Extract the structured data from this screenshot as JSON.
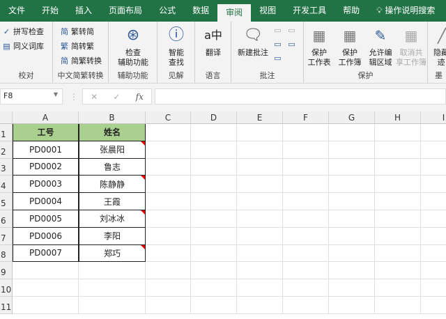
{
  "tabs": [
    "文件",
    "开始",
    "插入",
    "页面布局",
    "公式",
    "数据",
    "审阅",
    "视图",
    "开发工具",
    "帮助"
  ],
  "active_tab": "审阅",
  "tell_me": "操作说明搜索",
  "ribbon": {
    "proofing": {
      "spell": "拼写检查",
      "thesaurus": "同义词库",
      "label": "校对"
    },
    "chinese": {
      "t2s": "繁转简",
      "s2t": "简转繁",
      "convert": "简繁转换",
      "label": "中文简繁转换"
    },
    "access": {
      "check1": "检查",
      "check2": "辅助功能",
      "label": "辅助功能"
    },
    "insights": {
      "smart1": "智能",
      "smart2": "查找",
      "label": "见解"
    },
    "language": {
      "translate": "翻译",
      "label": "语言"
    },
    "comments": {
      "new": "新建批注",
      "label": "批注"
    },
    "protect": {
      "sheet1": "保护",
      "sheet2": "工作表",
      "book1": "保护",
      "book2": "工作簿",
      "allow1": "允许编",
      "allow2": "辑区域",
      "unshare1": "取消共",
      "unshare2": "享工作簿",
      "label": "保护"
    },
    "ink": {
      "hide1": "隐藏",
      "hide2": "迹",
      "label": "墨"
    }
  },
  "formula_bar": {
    "name_box": "F8",
    "formula": ""
  },
  "columns": [
    "A",
    "B",
    "C",
    "D",
    "E",
    "F",
    "G",
    "H",
    "I"
  ],
  "rows": [
    "1",
    "2",
    "3",
    "4",
    "5",
    "6",
    "7",
    "8",
    "9",
    "10",
    "11"
  ],
  "table": {
    "headers": [
      "工号",
      "姓名"
    ],
    "data": [
      [
        "PD0001",
        "张晨阳"
      ],
      [
        "PD0002",
        "鲁志"
      ],
      [
        "PD0003",
        "陈静静"
      ],
      [
        "PD0004",
        "王霞"
      ],
      [
        "PD0005",
        "刘冰冰"
      ],
      [
        "PD0006",
        "李阳"
      ],
      [
        "PD0007",
        "郑巧"
      ]
    ],
    "comment_rows": [
      0,
      2,
      4,
      6
    ]
  },
  "colors": {
    "brand": "#217346",
    "header_fill": "#a9d08e",
    "comment": "#e00000"
  }
}
